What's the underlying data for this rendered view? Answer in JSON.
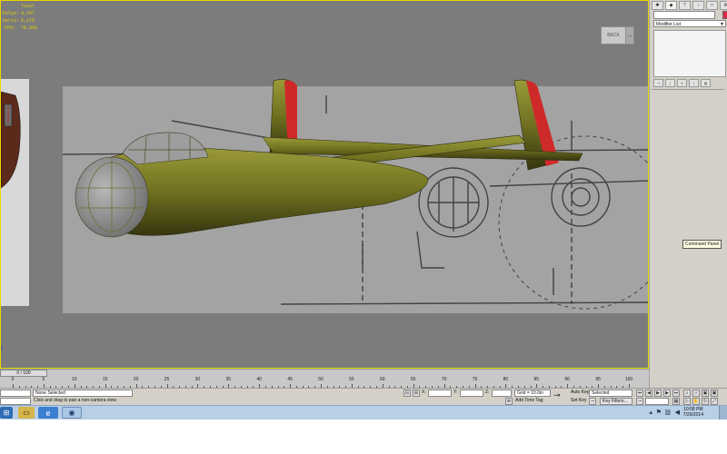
{
  "viewport": {
    "stats": [
      {
        "label": "",
        "value": "Total"
      },
      {
        "label": "Polys:",
        "value": "4,707"
      },
      {
        "label": "Verts:",
        "value": "6,176"
      },
      {
        "label": "",
        "value": ""
      },
      {
        "label": "FPS:",
        "value": "70.595"
      }
    ],
    "viewcube_face": "BACK",
    "viewcube_side": "LF",
    "axis_glyph": "/"
  },
  "command_panel": {
    "tabs": [
      "create-icon",
      "modify-icon",
      "hierarchy-icon",
      "motion-icon",
      "display-icon",
      "utilities-icon"
    ],
    "object_name": "",
    "object_color": "#d82a4a",
    "modifier_list": "Modifier List",
    "tooltip": "Command Panel"
  },
  "timeline": {
    "slider_label": "0 / 100",
    "ticks": [
      "0",
      "5",
      "10",
      "15",
      "20",
      "25",
      "30",
      "35",
      "40",
      "45",
      "50",
      "55",
      "60",
      "65",
      "70",
      "75",
      "80",
      "85",
      "90",
      "95",
      "100"
    ]
  },
  "status_bar": {
    "selection": "None Selected",
    "prompt": "Click and drag to pan a non-camera view",
    "x_label": "X:",
    "y_label": "Y:",
    "z_label": "Z:",
    "grid": "Grid = 10.0in",
    "add_time_tag": "Add Time Tag",
    "auto_key": "Auto Key",
    "selected_option": "Selected",
    "set_key": "Set Key",
    "key_filters": "Key Filters..."
  },
  "taskbar": {
    "time": "10:58 PM",
    "date": "7/29/2014"
  },
  "colors": {
    "fuselage": "#6f6f1e",
    "rudder": "#cf2a2a",
    "spinner": "#e8302c",
    "viewport_border": "#e8d600"
  }
}
